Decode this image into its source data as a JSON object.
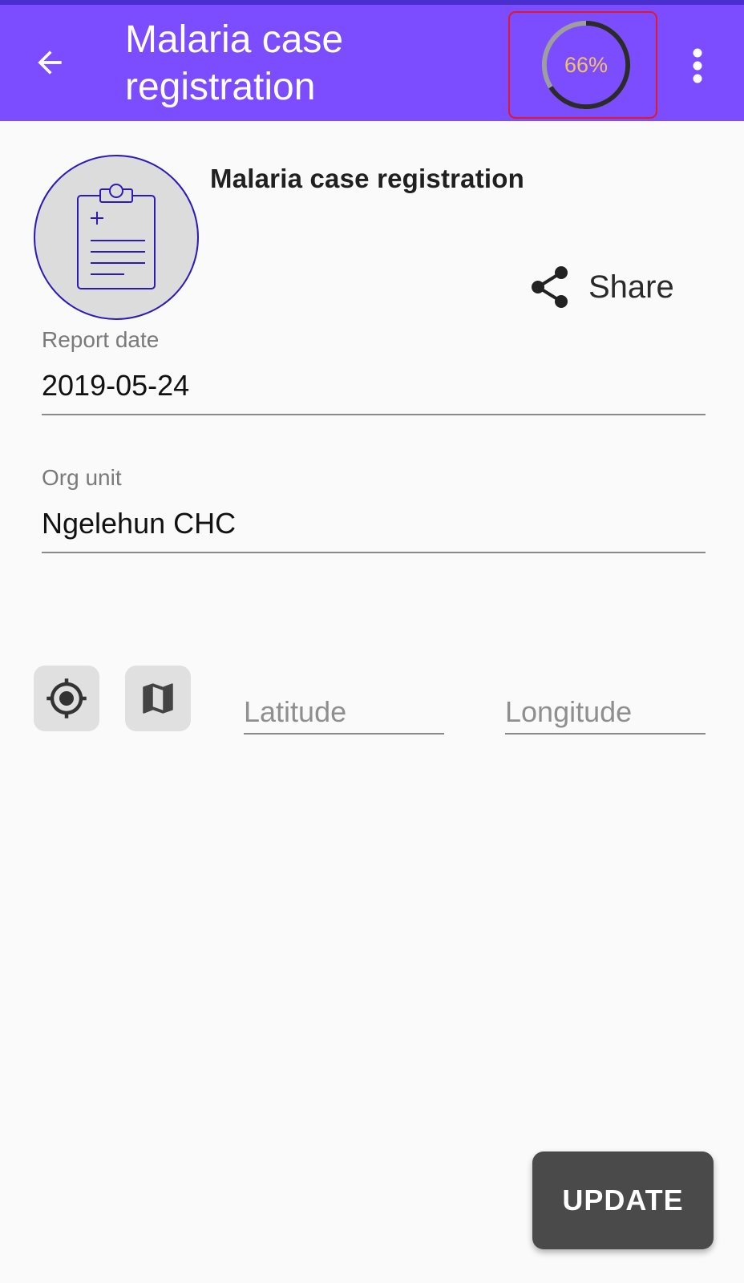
{
  "toolbar": {
    "title": "Malaria case registration",
    "back_icon": "arrow-left-icon",
    "menu_icon": "more-vertical-icon",
    "background_color": "#7c4dff"
  },
  "progress": {
    "percent": 66,
    "label": "66%",
    "text_color": "#f2c45c"
  },
  "program": {
    "name": "Malaria case registration",
    "icon": "clipboard-icon"
  },
  "share": {
    "label": "Share",
    "icon": "share-icon"
  },
  "fields": {
    "report_date": {
      "label": "Report date",
      "value": "2019-05-24"
    },
    "org_unit": {
      "label": "Org unit",
      "value": "Ngelehun CHC"
    }
  },
  "coordinates": {
    "latitude_placeholder": "Latitude",
    "longitude_placeholder": "Longitude",
    "location_icon": "gps-fixed-icon",
    "map_icon": "map-icon"
  },
  "actions": {
    "update_label": "UPDATE"
  }
}
